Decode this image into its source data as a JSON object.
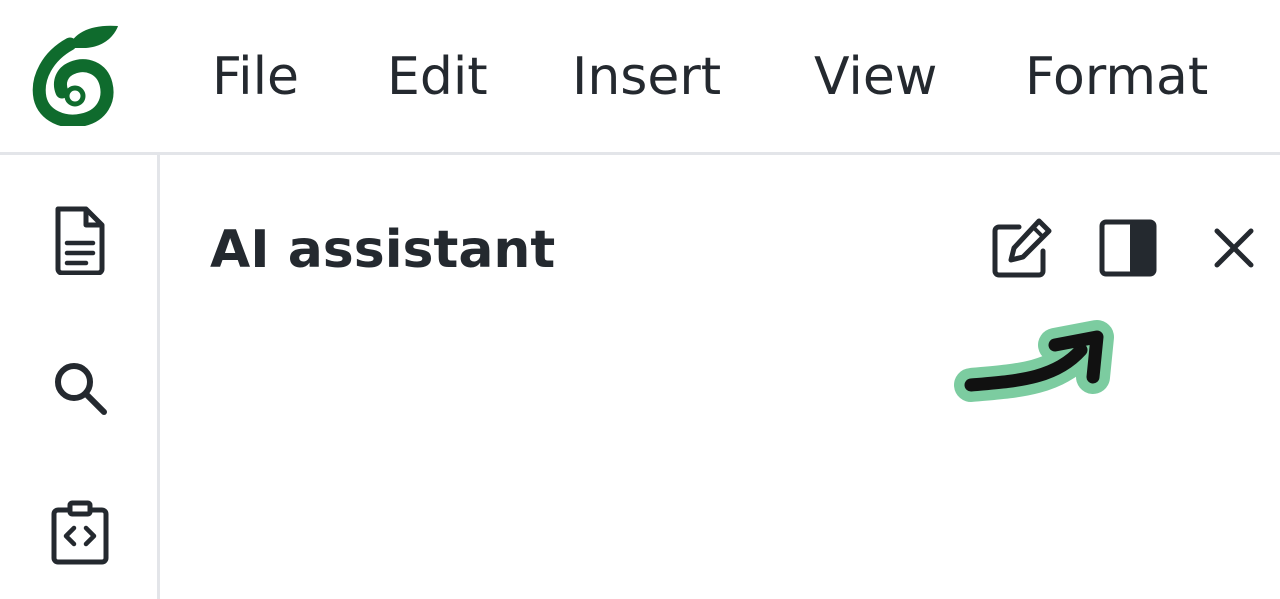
{
  "app": {
    "logo_icon": "overleaf-leaf-logo-icon",
    "brand_color": "#0f6b2d"
  },
  "menu": {
    "items": [
      {
        "label": "File"
      },
      {
        "label": "Edit"
      },
      {
        "label": "Insert"
      },
      {
        "label": "View"
      },
      {
        "label": "Format"
      }
    ]
  },
  "sidebar": {
    "items": [
      {
        "name": "file-tree",
        "icon": "document-icon"
      },
      {
        "name": "search",
        "icon": "search-icon"
      },
      {
        "name": "integrations",
        "icon": "code-clipboard-icon"
      }
    ]
  },
  "panel": {
    "title": "AI assistant",
    "actions": [
      {
        "name": "new-chat",
        "icon": "edit-icon"
      },
      {
        "name": "toggle-layout",
        "icon": "split-panel-icon"
      },
      {
        "name": "close",
        "icon": "close-icon"
      }
    ]
  },
  "annotation": {
    "icon": "arrow-pointer-icon",
    "highlight_color": "#7ccca0",
    "stroke_color": "#111111"
  }
}
